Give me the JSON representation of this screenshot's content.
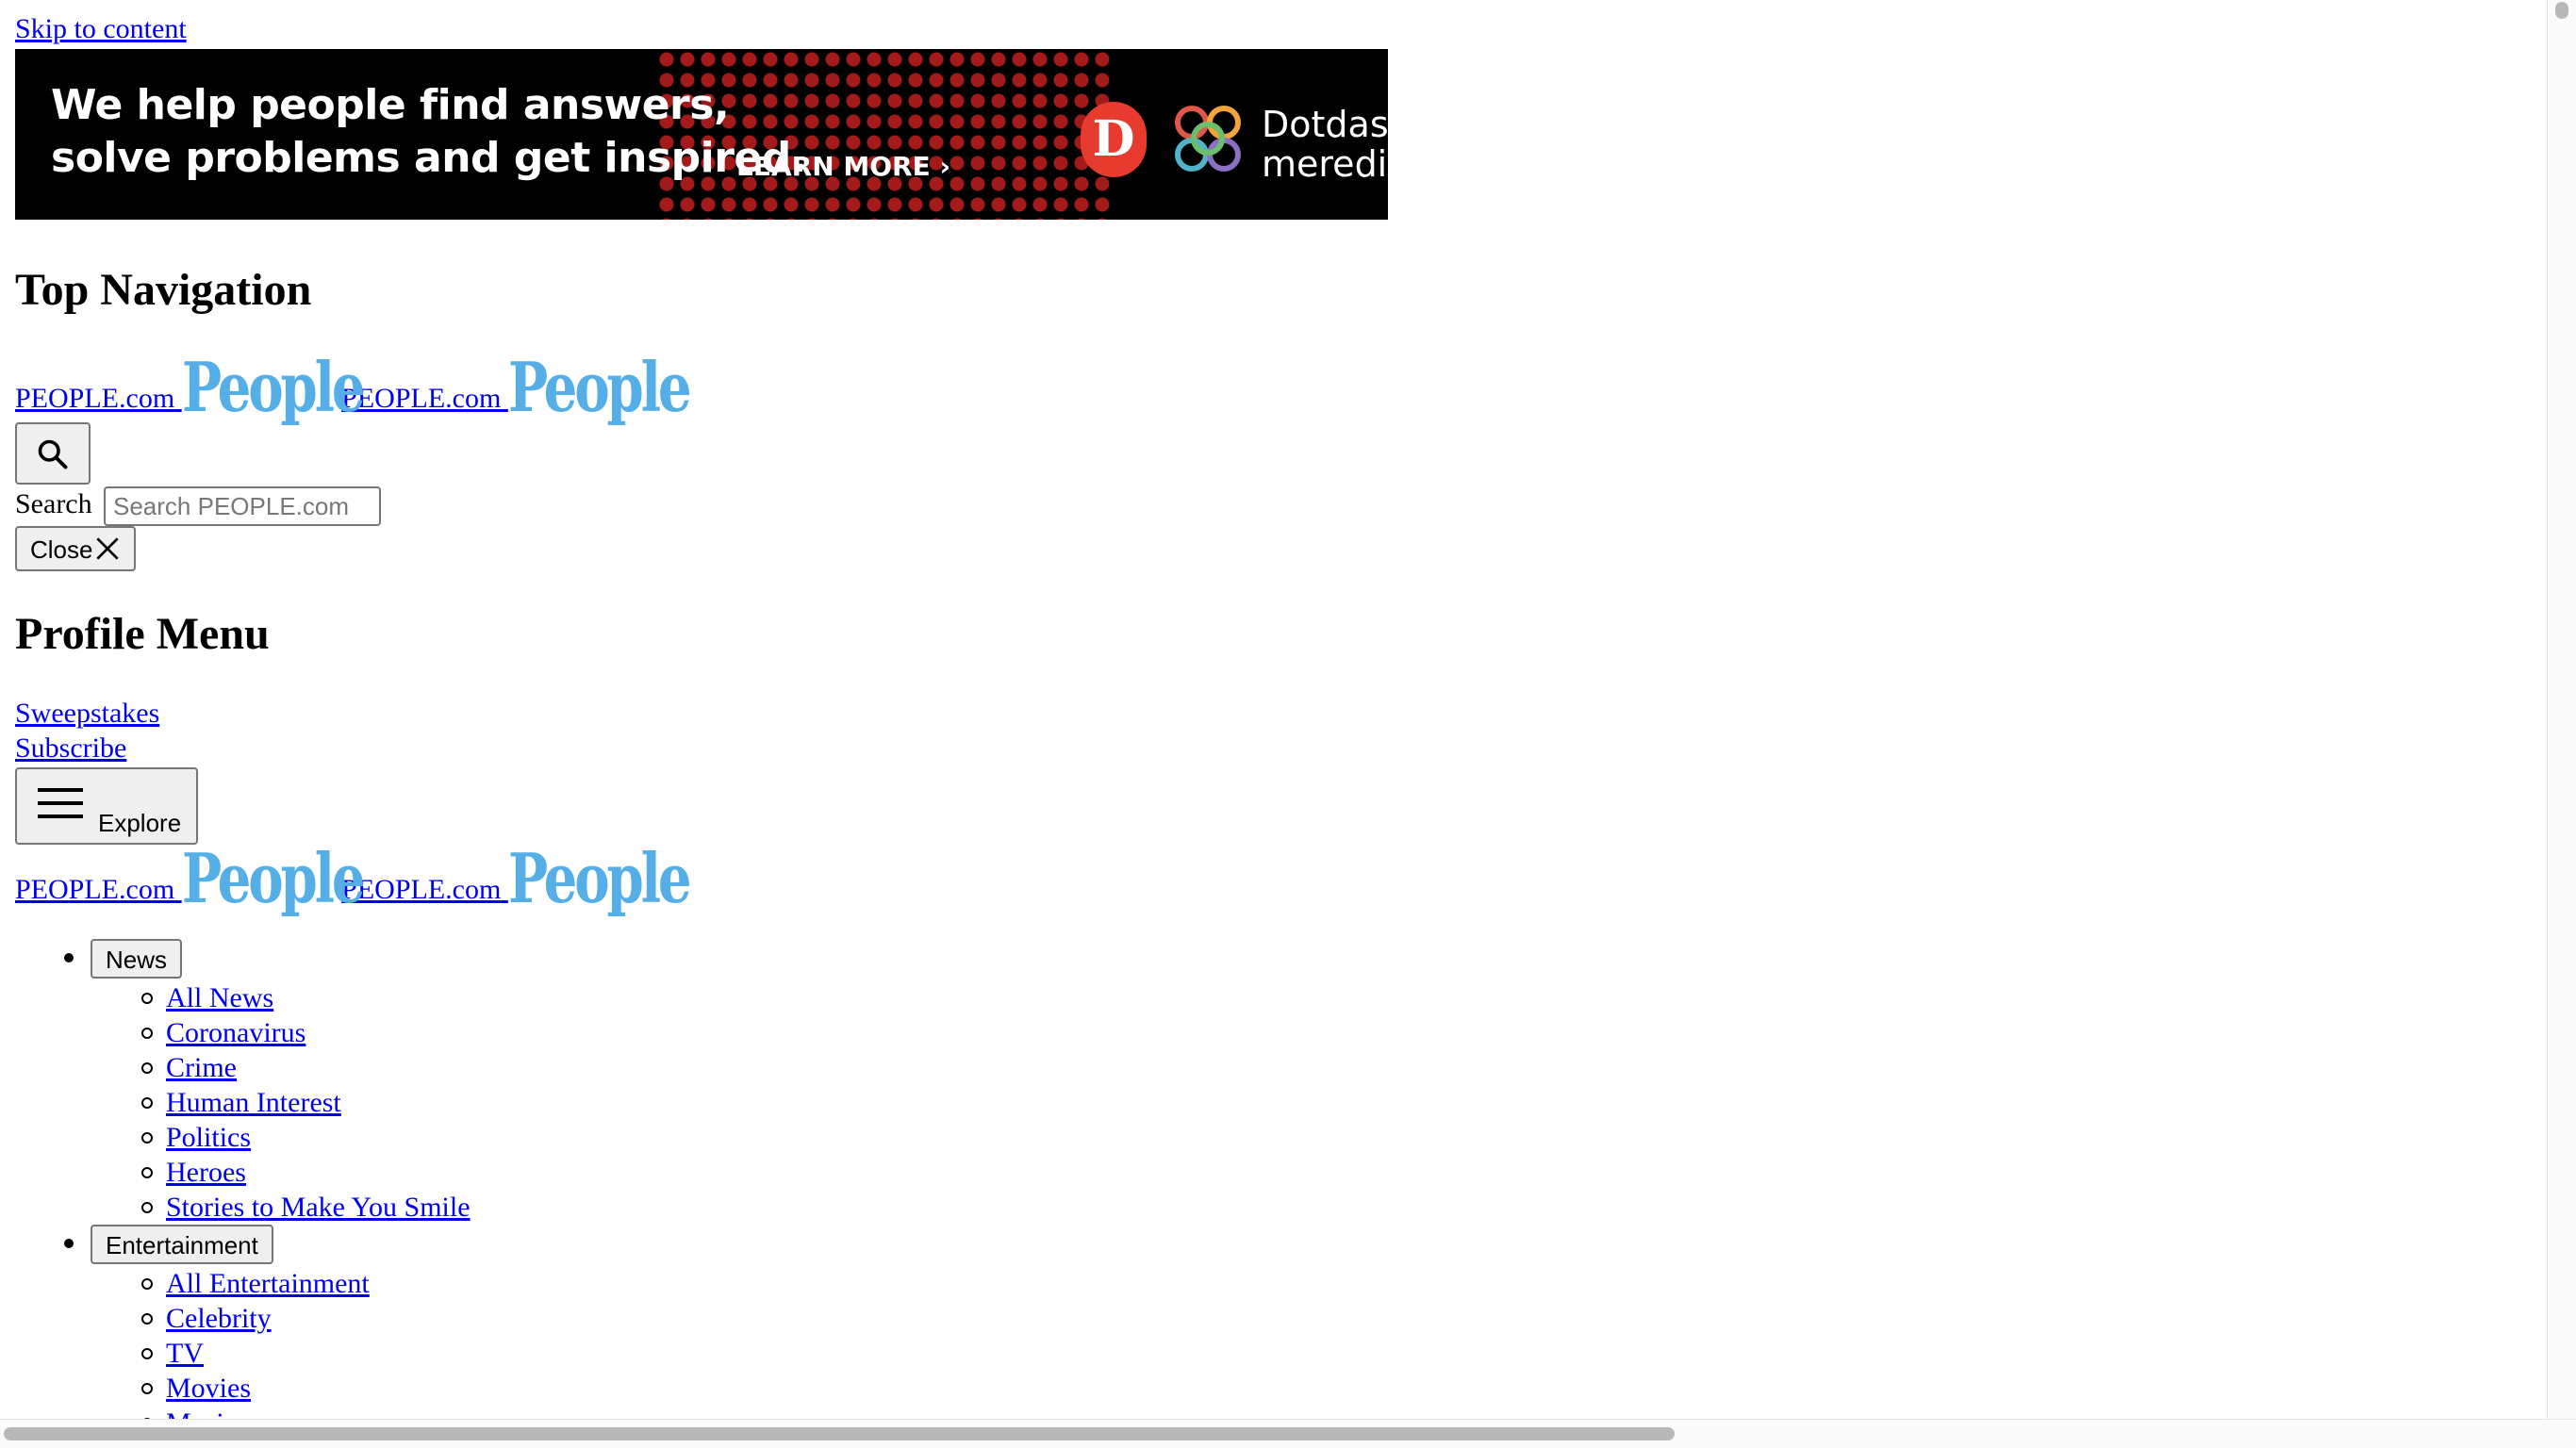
{
  "skip_link": "Skip to content",
  "banner": {
    "tagline_line1": "We help people find answers,",
    "tagline_line2": "solve problems and get inspired.",
    "cta": "LEARN MORE ›",
    "brand_line1": "Dotdash",
    "brand_line2": "meredith",
    "logo_letter": "D",
    "colors": {
      "background": "#000000",
      "accent": "#e63b2e"
    }
  },
  "top_nav": {
    "heading": "Top Navigation",
    "site_link": "PEOPLE.com",
    "logo_text": "People",
    "search_label": "Search",
    "search_placeholder": "Search PEOPLE.com",
    "close_label": "Close",
    "icons": {
      "search": "search-icon",
      "close": "close-icon"
    }
  },
  "profile_menu": {
    "heading": "Profile Menu",
    "links": [
      "Sweepstakes",
      "Subscribe"
    ],
    "explore_label": "Explore",
    "icon": "hamburger-icon"
  },
  "nav": {
    "categories": [
      {
        "label": "News",
        "items": [
          "All News",
          "Coronavirus",
          "Crime",
          "Human Interest",
          "Politics",
          "Heroes",
          "Stories to Make You Smile"
        ]
      },
      {
        "label": "Entertainment",
        "items": [
          "All Entertainment",
          "Celebrity",
          "TV",
          "Movies",
          "Music"
        ]
      }
    ]
  },
  "colors": {
    "link": "#0000ee",
    "logo": "#55aee6"
  }
}
